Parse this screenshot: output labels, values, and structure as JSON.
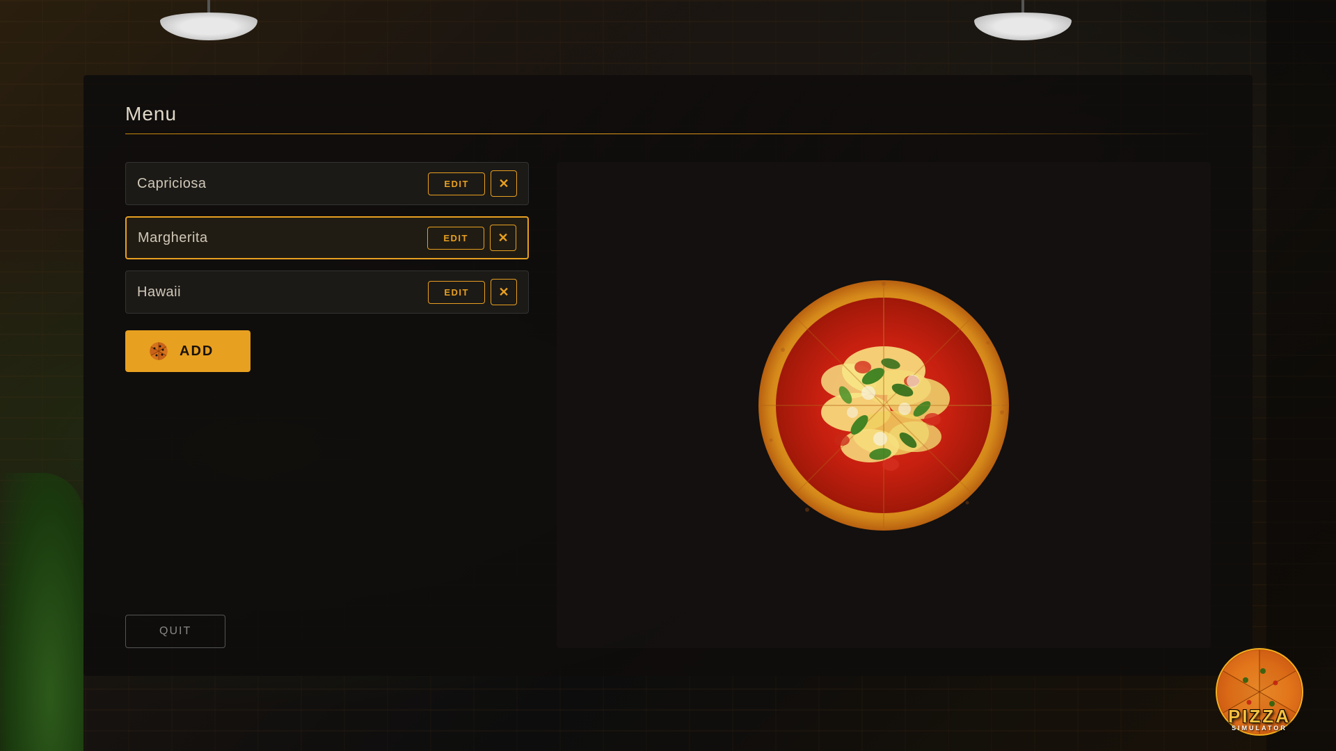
{
  "panel": {
    "title": "Menu",
    "title_divider": true
  },
  "pizzas": [
    {
      "id": "capriciosa",
      "name": "Capriciosa",
      "selected": false,
      "edit_label": "EDIT",
      "delete_label": "×"
    },
    {
      "id": "margherita",
      "name": "Margherita",
      "selected": true,
      "edit_label": "EDIT",
      "delete_label": "×"
    },
    {
      "id": "hawaii",
      "name": "Hawaii",
      "selected": false,
      "edit_label": "EDIT",
      "delete_label": "×"
    }
  ],
  "add_button": {
    "label": "ADD"
  },
  "quit_button": {
    "label": "QUIT"
  },
  "logo": {
    "pizza_word": "PIZZA",
    "simulator_word": "SIMULATOR"
  },
  "colors": {
    "accent": "#e8a020",
    "panel_bg": "rgba(15,13,12,0.93)",
    "selected_border": "#e8a020"
  }
}
